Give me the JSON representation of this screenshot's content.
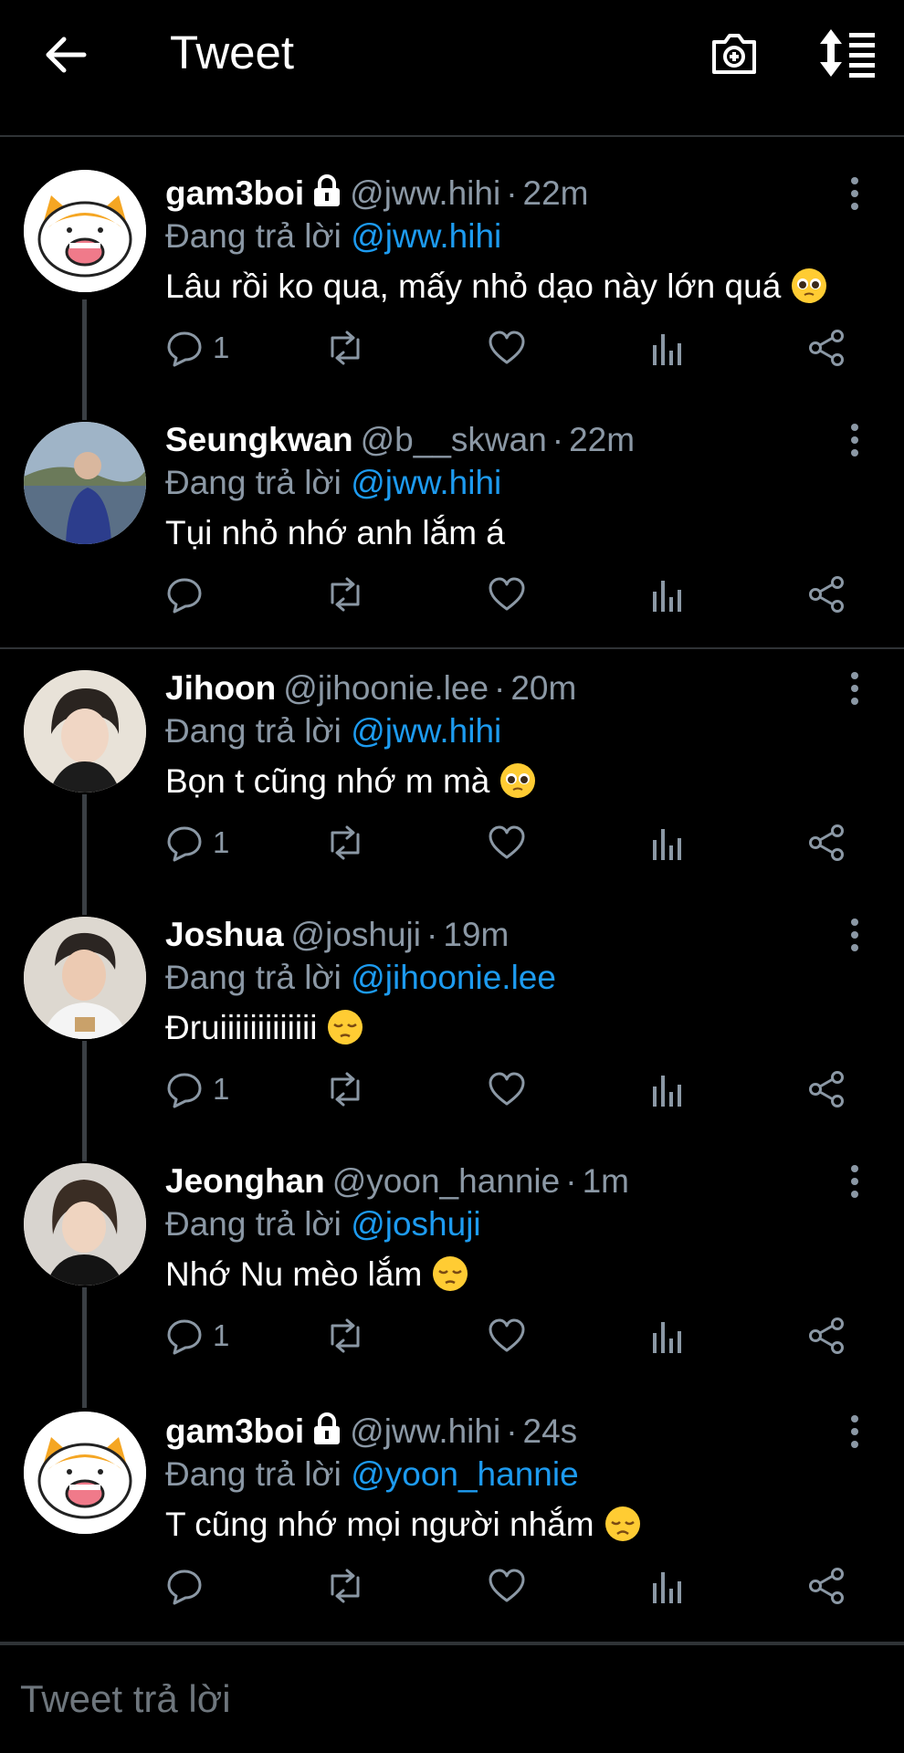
{
  "header": {
    "title": "Tweet",
    "back_icon": "arrow-left-icon",
    "camera_icon": "camera-plus-icon",
    "sort_icon": "sort-icon"
  },
  "colors": {
    "background": "#000000",
    "link": "#1d9bf0",
    "muted": "#8b98a5",
    "divider": "#2f3336"
  },
  "tweets": [
    {
      "name": "gam3boi",
      "locked": true,
      "handle": "@jww.hihi",
      "separator": "·",
      "time": "22m",
      "reply_prefix": "Đang trả lời",
      "reply_to": "@jww.hihi",
      "text": "Lâu rồi ko qua, mấy nhỏ dạo này lớn quá",
      "emoji": "pleading-face-emoji",
      "reply_count": "1",
      "avatar": "cartoon-shiba-avatar"
    },
    {
      "name": "Seungkwan",
      "locked": false,
      "handle": "@b__skwan",
      "separator": "·",
      "time": "22m",
      "reply_prefix": "Đang trả lời",
      "reply_to": "@jww.hihi",
      "text": "Tụi nhỏ nhớ anh lắm á",
      "emoji": "",
      "reply_count": "",
      "avatar": "photo-avatar"
    },
    {
      "name": "Jihoon",
      "locked": false,
      "handle": "@jihoonie.lee",
      "separator": "·",
      "time": "20m",
      "reply_prefix": "Đang trả lời",
      "reply_to": "@jww.hihi",
      "text": "Bọn t cũng nhớ m mà",
      "emoji": "pleading-face-emoji",
      "reply_count": "1",
      "avatar": "photo-avatar"
    },
    {
      "name": "Joshua",
      "locked": false,
      "handle": "@joshuji",
      "separator": "·",
      "time": "19m",
      "reply_prefix": "Đang trả lời",
      "reply_to": "@jihoonie.lee",
      "text": "Đruiiiiiiiiiiiii",
      "emoji": "pensive-face-emoji",
      "reply_count": "1",
      "avatar": "photo-avatar"
    },
    {
      "name": "Jeonghan",
      "locked": false,
      "handle": "@yoon_hannie",
      "separator": "·",
      "time": "1m",
      "reply_prefix": "Đang trả lời",
      "reply_to": "@joshuji",
      "text": "Nhớ Nu mèo lắm",
      "emoji": "pensive-face-emoji",
      "reply_count": "1",
      "avatar": "photo-avatar"
    },
    {
      "name": "gam3boi",
      "locked": true,
      "handle": "@jww.hihi",
      "separator": "·",
      "time": "24s",
      "reply_prefix": "Đang trả lời",
      "reply_to": "@yoon_hannie",
      "text": "T cũng nhớ mọi người nhắm",
      "emoji": "disappointed-face-emoji",
      "reply_count": "",
      "avatar": "cartoon-shiba-avatar"
    }
  ],
  "compose": {
    "placeholder": "Tweet trả lời"
  }
}
